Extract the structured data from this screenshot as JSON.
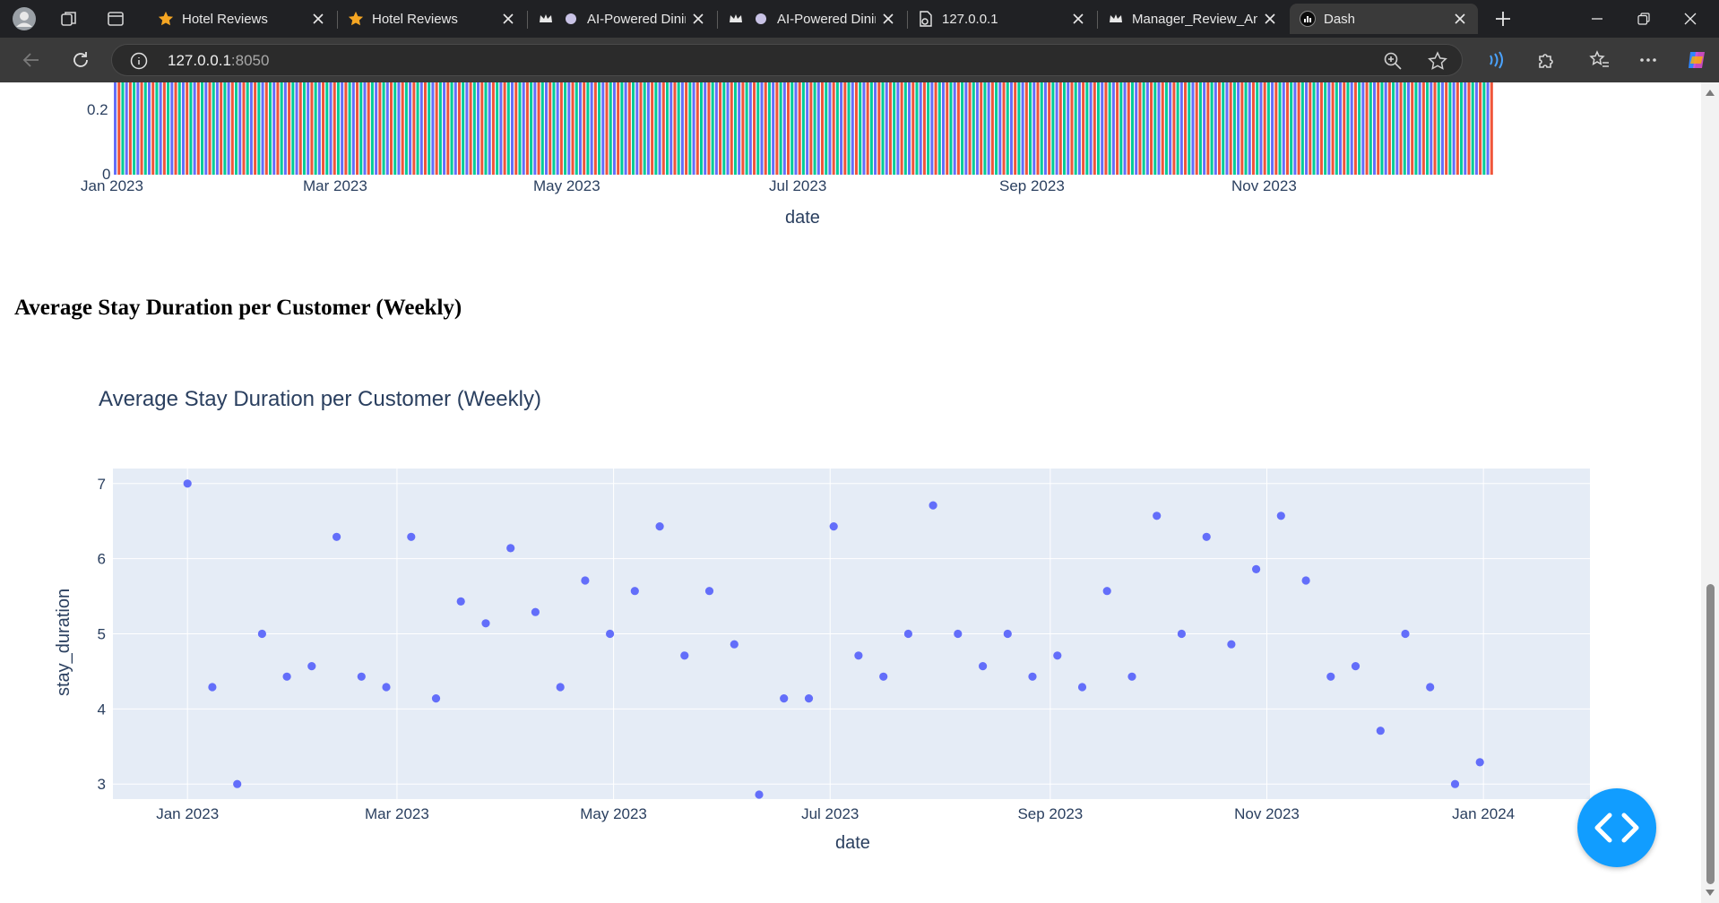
{
  "browser": {
    "tabs": [
      {
        "title": "Hotel Reviews",
        "icon": "star-icon"
      },
      {
        "title": "Hotel Reviews",
        "icon": "star-icon"
      },
      {
        "title": "AI-Powered Dinin",
        "icon": "crown-icon"
      },
      {
        "title": "AI-Powered Dinin",
        "icon": "crown-icon"
      },
      {
        "title": "127.0.0.1",
        "icon": "file-icon"
      },
      {
        "title": "Manager_Review_An",
        "icon": "crown-icon"
      },
      {
        "title": "Dash",
        "icon": "dash-icon",
        "active": true
      }
    ],
    "url_host": "127.0.0.1",
    "url_port": ":8050"
  },
  "top_chart": {
    "y_tick_labels": [
      "0.2",
      "0"
    ],
    "x_tick_labels": [
      "Jan 2023",
      "Mar 2023",
      "May 2023",
      "Jul 2023",
      "Sep 2023",
      "Nov 2023"
    ],
    "xlabel": "date",
    "colors": [
      "#636efa",
      "#ef553b",
      "#00cc96"
    ]
  },
  "section_heading": "Average Stay Duration per Customer (Weekly)",
  "chart_data": {
    "type": "scatter",
    "title": "Average Stay Duration per Customer (Weekly)",
    "xlabel": "date",
    "ylabel": "stay_duration",
    "x_tick_labels": [
      "Jan 2023",
      "Mar 2023",
      "May 2023",
      "Jul 2023",
      "Sep 2023",
      "Nov 2023",
      "Jan 2024"
    ],
    "y_tick_labels": [
      "3",
      "4",
      "5",
      "6",
      "7"
    ],
    "ylim": [
      2.8,
      7.2
    ],
    "xlim": [
      "2022-12-11",
      "2024-01-31"
    ],
    "grid": true,
    "marker_color": "#636efa",
    "plot_bg": "#e5ecf6",
    "series": [
      {
        "x": [
          "2023-01-01",
          "2023-01-08",
          "2023-01-15",
          "2023-01-22",
          "2023-01-29",
          "2023-02-05",
          "2023-02-12",
          "2023-02-19",
          "2023-02-26",
          "2023-03-05",
          "2023-03-12",
          "2023-03-19",
          "2023-03-26",
          "2023-04-02",
          "2023-04-09",
          "2023-04-16",
          "2023-04-23",
          "2023-04-30",
          "2023-05-07",
          "2023-05-14",
          "2023-05-21",
          "2023-05-28",
          "2023-06-04",
          "2023-06-11",
          "2023-06-18",
          "2023-06-25",
          "2023-07-02",
          "2023-07-09",
          "2023-07-16",
          "2023-07-23",
          "2023-07-30",
          "2023-08-06",
          "2023-08-13",
          "2023-08-20",
          "2023-08-27",
          "2023-09-03",
          "2023-09-10",
          "2023-09-17",
          "2023-09-24",
          "2023-10-01",
          "2023-10-08",
          "2023-10-15",
          "2023-10-22",
          "2023-10-29",
          "2023-11-05",
          "2023-11-12",
          "2023-11-19",
          "2023-11-26",
          "2023-12-03",
          "2023-12-10",
          "2023-12-17",
          "2023-12-24",
          "2023-12-31"
        ],
        "y": [
          7.0,
          4.29,
          3.0,
          5.0,
          4.43,
          4.57,
          6.29,
          4.43,
          4.29,
          6.29,
          4.14,
          5.43,
          5.14,
          6.14,
          5.29,
          4.29,
          5.71,
          5.0,
          5.57,
          6.43,
          4.71,
          5.57,
          4.86,
          2.86,
          4.14,
          4.14,
          6.43,
          4.71,
          4.43,
          5.0,
          6.71,
          5.0,
          4.57,
          5.0,
          4.43,
          4.71,
          4.29,
          5.57,
          4.43,
          6.57,
          5.0,
          6.29,
          4.86,
          5.86,
          6.57,
          5.71,
          4.43,
          4.57,
          3.71,
          5.0,
          4.29,
          3.0,
          3.29
        ]
      }
    ]
  }
}
